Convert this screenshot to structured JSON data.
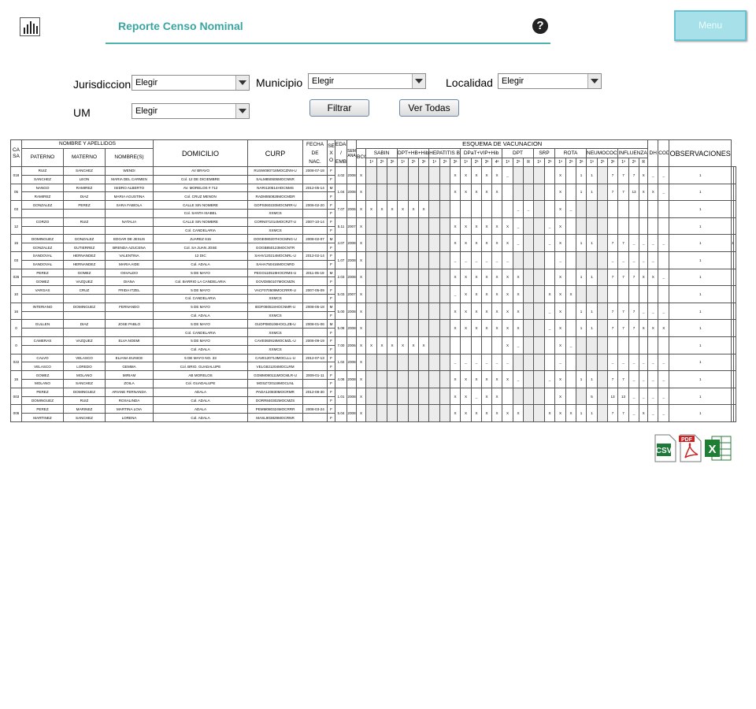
{
  "header": {
    "title": "Reporte Censo Nominal",
    "help_icon": "question-circle-icon",
    "help_symbol": "?",
    "menu_label": "Menu",
    "logo_icon": "bar-chart-icon"
  },
  "filters": {
    "jurisdiccion_label": "Jurisdiccion",
    "jurisdiccion_value": "Elegir",
    "municipio_label": "Municipio",
    "municipio_value": "Elegir",
    "localidad_label": "Localidad",
    "localidad_value": "Elegir",
    "um_label": "UM",
    "um_value": "Elegir",
    "filtrar_label": "Filtrar",
    "ver_todas_label": "Ver Todas"
  },
  "table": {
    "h_casa": "CASA",
    "h_nombre_apellidos": "NOMBRE Y APELLIDOS",
    "h_paterno": "PATERNO",
    "h_materno": "MATERNO",
    "h_nombres": "NOMBRE(S)",
    "h_domicilio": "DOMICILIO",
    "h_curp": "CURP",
    "h_fecha": "FECHA",
    "h_de": "DE",
    "h_nac": "NAC.",
    "h_sexo": "SEXO",
    "h_edad": "EDAD",
    "h_slash": "/",
    "h_emb": "EMB.",
    "h_semana": "SEMANA",
    "h_esquema": "ESQUEMA DE VACUNACION",
    "h_bcg": "BCG",
    "h_sabin": "SABIN",
    "h_dpt_hb_hib": "DPT+HB+Hib",
    "h_hepatitis": "HEPATITIS B",
    "h_dpat": "DPaT+VIP+Hib",
    "h_dpt": "DPT",
    "h_srp": "SRP",
    "h_rota": "ROTA",
    "h_neumococo": "NEUMOCOCO",
    "h_influenza": "INFLUENZA",
    "h_dh": "DH",
    "h_cod": "COD",
    "h_observaciones": "OBSERVACIONES",
    "dose_headers": [
      "1ª",
      "2ª",
      "3ª",
      "1ª",
      "2ª",
      "3ª",
      "1ª",
      "2ª",
      "3ª",
      "1ª",
      "2ª",
      "3ª",
      "4ª",
      "1ª",
      "2ª",
      "R",
      "1ª",
      "2ª",
      "1ª",
      "2ª",
      "3ª",
      "1ª",
      "2ª",
      "3ª",
      "1ª",
      "2ª",
      "R"
    ],
    "rows": [
      {
        "casa": "018",
        "a": [
          "RUIZ",
          "SANCHEZ",
          "WENDI",
          "AV BRAVO",
          "RUSW080718MOCZNN-U",
          "2008-07-18",
          "F"
        ],
        "b": [
          "SANCHEZ",
          "LEON",
          "MARIA DEL CARMEN",
          "Col. 12 DE DICIEMBRE",
          "SALM850606MOCNNR",
          "F"
        ],
        "edad": "4.02",
        "semana": "2008",
        "v": [
          "X",
          "",
          "",
          "",
          "",
          "",
          "",
          "",
          "",
          "X",
          "X",
          "X",
          "X",
          "X",
          "_",
          "",
          "",
          "",
          "",
          "X",
          "",
          "1",
          "1",
          "",
          "7",
          "7",
          "7",
          "X",
          "_",
          "_"
        ],
        "dh": "1",
        "cod": ""
      },
      {
        "casa": "05",
        "a": [
          "NANGO",
          "RAMIREZ",
          "ISIDRO ALBERTO",
          "AV. MORELOS # 712",
          "NARI120514HOCNMS",
          "2012-05-14",
          "M"
        ],
        "b": [
          "RAMIREZ",
          "DIAZ",
          "MARIA AGUSTINA",
          "Col. CRUZ MENON",
          "RADM850828MOCMDR",
          "F"
        ],
        "edad": "1.04",
        "semana": "2008",
        "v": [
          "X",
          "",
          "",
          "",
          "",
          "",
          "",
          "",
          "",
          "X",
          "X",
          "X",
          "X",
          "X",
          "",
          "",
          "",
          "",
          "",
          "X",
          "",
          "1",
          "1",
          "",
          "7",
          "7",
          "13",
          "X",
          "X",
          "_"
        ],
        "dh": "1",
        "cod": ""
      },
      {
        "casa": "03",
        "a": [
          "GONZALEZ",
          "PEREZ",
          "SARA FABIOLA",
          "CALLE SIN NOMBRE",
          "GOPS060220MOCNRR-U",
          "2006-02-20",
          "F"
        ],
        "b": [
          "",
          "",
          "",
          "Col. SANTA ISABEL",
          "XXMCS",
          "F"
        ],
        "edad": "7.07",
        "semana": "2006",
        "v": [
          "X",
          "X",
          "X",
          "X",
          "X",
          "X",
          "X",
          "",
          "",
          "",
          "",
          "",
          "",
          "",
          "",
          "_",
          "_",
          "",
          "",
          "X",
          "_",
          "",
          "",
          "",
          "",
          "",
          "",
          "",
          "",
          ""
        ],
        "dh": "1",
        "cod": ""
      },
      {
        "casa": "12",
        "a": [
          "CORZO",
          "RUIZ",
          "NATALIA",
          "CALLE SIN NOMBRE",
          "CORN071014MOCRZT-U",
          "2007-10-14",
          "F"
        ],
        "b": [
          "",
          "",
          "",
          "Col. CANDELARIA",
          "XXMCS",
          "F"
        ],
        "edad": "5.11",
        "semana": "2007",
        "v": [
          "X",
          "",
          "",
          "",
          "",
          "",
          "",
          "",
          "",
          "X",
          "X",
          "X",
          "X",
          "X",
          "X",
          "_",
          "",
          "",
          "_",
          "X",
          "",
          "",
          "",
          "",
          "",
          "",
          "",
          "",
          "",
          ""
        ],
        "dh": "1",
        "cod": ""
      },
      {
        "casa": "15",
        "a": [
          "DOMINGUEZ",
          "GONZALEZ",
          "EDGAR DE JESUS",
          "JUAREZ 615",
          "DOGE080207HOCMNG-U",
          "2008-02-07",
          "M"
        ],
        "b": [
          "GONZALEZ",
          "GUTIERREZ",
          "BRENDA AZUCENA",
          "Col. SA JUAN JOSE",
          "GOGB850123MOCNTR",
          "F"
        ],
        "edad": "4.07",
        "semana": "2008",
        "v": [
          "X",
          "",
          "",
          "",
          "",
          "",
          "",
          "",
          "",
          "X",
          "X",
          "X",
          "X",
          "X",
          "X",
          "_",
          "",
          "",
          "_",
          "X",
          "",
          "1",
          "1",
          "",
          "7",
          "7",
          "_",
          "_",
          "_",
          "_"
        ],
        "dh": "1",
        "cod": "1"
      },
      {
        "casa": "03",
        "a": [
          "SANDOVAL",
          "HERNANDEZ",
          "VALENTINA",
          "12 DIC",
          "SAHV120214MOCNRL-U",
          "2012-02-14",
          "F"
        ],
        "b": [
          "SANDOVAL",
          "HERNANDEZ",
          "MARIA AIDE",
          "Col. ADALA",
          "SAHA750416MOCNRD",
          "F"
        ],
        "edad": "1.07",
        "semana": "2008",
        "v": [
          "X",
          "",
          "",
          "",
          "",
          "",
          "",
          "",
          "",
          "_",
          "_",
          "_",
          "_",
          "_",
          "_",
          "",
          "",
          "",
          "",
          "_",
          "",
          "",
          "",
          "",
          "_",
          "_",
          "_",
          "_",
          "_",
          ""
        ],
        "dh": "1",
        "cod": ""
      },
      {
        "casa": "026",
        "a": [
          "PEREZ",
          "GOMEZ",
          "OSVALDO",
          "5 DE MAYO",
          "PEGO110519HOCRMS-U",
          "2011-05-19",
          "M"
        ],
        "b": [
          "GOMEZ",
          "VAZQUEZ",
          "DIANA",
          "Col. BARRIO LA CANDELARIA",
          "GOVD850107MOCMZN",
          "F"
        ],
        "edad": "2.03",
        "semana": "2008",
        "v": [
          "X",
          "",
          "",
          "",
          "",
          "",
          "",
          "",
          "",
          "X",
          "X",
          "X",
          "X",
          "X",
          "X",
          "X",
          "",
          "",
          "",
          "X",
          "",
          "1",
          "1",
          "",
          "7",
          "7",
          "7",
          "X",
          "X",
          "_"
        ],
        "dh": "1",
        "cod": ""
      },
      {
        "casa": "10",
        "a": [
          "VARGAS",
          "CRUZ",
          "FRIDA ITZEL",
          "5 DE MAYO",
          "VACF070509MOCRRR-U",
          "2007-05-09",
          "F"
        ],
        "b": [
          "",
          "",
          "",
          "Col. CANDELARIA",
          "XXMCS",
          "F"
        ],
        "edad": "5.03",
        "semana": "2007",
        "v": [
          "X",
          "",
          "",
          "",
          "",
          "",
          "",
          "",
          "",
          "_",
          "X",
          "X",
          "X",
          "X",
          "X",
          "X",
          "",
          "",
          "X",
          "X",
          "X",
          "",
          "",
          "",
          "",
          "",
          "",
          "",
          "",
          ""
        ],
        "dh": "1",
        "cod": ""
      },
      {
        "casa": "16",
        "a": [
          "INTERIANO",
          "DOMINGUEZ",
          "FERNANDO",
          "5 DE MAYO",
          "IEDF080518HOCNMR-U",
          "2008-05-18",
          "M"
        ],
        "b": [
          "",
          "",
          "",
          "Col. ADALA",
          "XXMCS",
          "F"
        ],
        "edad": "5.00",
        "semana": "2008",
        "v": [
          "X",
          "",
          "",
          "",
          "",
          "",
          "",
          "",
          "",
          "X",
          "X",
          "X",
          "X",
          "X",
          "X",
          "X",
          "",
          "",
          "_",
          "X",
          "",
          "1",
          "1",
          "",
          "7",
          "7",
          "7",
          "_",
          "_",
          "_"
        ],
        "dh": "1",
        "cod": ""
      },
      {
        "casa": "0",
        "a": [
          "GULLEN",
          "DIAZ",
          "JOSE PABLO",
          "5 DE MAYO",
          "GUDP080106HOCLZB-U",
          "2008-01-06",
          "M"
        ],
        "b": [
          "",
          "",
          "",
          "Col. CANDELARIA",
          "XXMCS",
          "F"
        ],
        "edad": "5.08",
        "semana": "2008",
        "v": [
          "X",
          "",
          "",
          "",
          "",
          "",
          "",
          "",
          "",
          "X",
          "X",
          "X",
          "X",
          "X",
          "X",
          "X",
          "",
          "",
          "_",
          "X",
          "",
          "1",
          "1",
          "",
          "7",
          "7",
          "7",
          "X",
          "X",
          "X"
        ],
        "dh": "1",
        "cod": ""
      },
      {
        "casa": "0",
        "a": [
          "CAMERAS",
          "VAZQUEZ",
          "ELVA NOEMI",
          "5 DE MAYO",
          "CAVE060919MOCMZL-U",
          "2006-09-19",
          "F"
        ],
        "b": [
          "",
          "",
          "",
          "Col. ADALA",
          "XXMCS",
          "F"
        ],
        "edad": "7.00",
        "semana": "2006",
        "v": [
          "X",
          "X",
          "X",
          "X",
          "X",
          "X",
          "X",
          "",
          "",
          "",
          "",
          "",
          "",
          "",
          "X",
          "_",
          "",
          "",
          "",
          "X",
          "_",
          "",
          "",
          "",
          "",
          "",
          "",
          "",
          "",
          ""
        ],
        "dh": "1",
        "cod": ""
      },
      {
        "casa": "022",
        "a": [
          "CALVO",
          "VELASCO",
          "ELIANA EUNICE",
          "5 DE MAYO NO. 33",
          "CAVE120713MOCLLL-U",
          "2012-07-13",
          "F"
        ],
        "b": [
          "VELASCO",
          "LOREDO",
          "GEMMA",
          "Col. BRIO. GUADALUPE",
          "VELG821204MOCLRM",
          "F"
        ],
        "edad": "1.02",
        "semana": "2008",
        "v": [
          "X",
          "",
          "",
          "",
          "",
          "",
          "",
          "",
          "",
          "_",
          "_",
          "_",
          "_",
          "_",
          "_",
          "",
          "",
          "",
          "",
          "_",
          "",
          "",
          "",
          "",
          "_",
          "_",
          "_",
          "_",
          "_",
          "_"
        ],
        "dh": "1",
        "cod": ""
      },
      {
        "casa": "15",
        "a": [
          "GOMEZ",
          "MOLANO",
          "MIRIAM",
          "AB MORELOS",
          "GOMM090111MOCMLR-U",
          "2009-01-11",
          "F"
        ],
        "b": [
          "MOLANO",
          "SANCHEZ",
          "ZOILA",
          "Col. GUADALUPE",
          "MOSZ720119MOCLNL",
          "F"
        ],
        "edad": "4.06",
        "semana": "2008",
        "v": [
          "X",
          "",
          "",
          "",
          "",
          "",
          "",
          "",
          "",
          "X",
          "X",
          "X",
          "X",
          "X",
          "X",
          "_",
          "",
          "",
          "_",
          "X",
          "",
          "1",
          "1",
          "",
          "7",
          "7",
          "_",
          "_",
          "_",
          "_"
        ],
        "dh": "1",
        "cod": ""
      },
      {
        "casa": "003",
        "a": [
          "PEREZ",
          "DOMINGUEZ",
          "ARIANE FERNANDA",
          "ADALA",
          "PADA120830MOCRMR",
          "2012-08-30",
          "F"
        ],
        "b": [
          "DOMINGUEZ",
          "RUIZ",
          "ROSALINDA",
          "Col. ADALA",
          "DORR840302MOCMZS",
          "F"
        ],
        "edad": "1.01",
        "semana": "2008",
        "v": [
          "X",
          "",
          "",
          "",
          "",
          "",
          "",
          "",
          "",
          "X",
          "X",
          "_",
          "X",
          "X",
          "",
          "",
          "",
          "",
          "",
          "X",
          "",
          "",
          "5",
          "",
          "13",
          "13",
          "_",
          "_",
          "_",
          "_"
        ],
        "dh": "1",
        "cod": ""
      },
      {
        "casa": "006",
        "a": [
          "PEREZ",
          "MARINEZ",
          "MARTINA LOIA",
          "ADALA",
          "PEMM080324MOCRRR",
          "2008-03-24",
          "F"
        ],
        "b": [
          "MARTINEZ",
          "SANCHEZ",
          "LORENA",
          "Col. ADALA",
          "MASL903829MOCRNR",
          "F"
        ],
        "edad": "5.04",
        "semana": "2008",
        "v": [
          "X",
          "",
          "",
          "",
          "",
          "",
          "",
          "",
          "",
          "X",
          "X",
          "X",
          "X",
          "X",
          "X",
          "X",
          "",
          "",
          "X",
          "X",
          "X",
          "1",
          "1",
          "",
          "7",
          "7",
          "_",
          "X",
          "_",
          "_"
        ],
        "dh": "1",
        "cod": ""
      }
    ]
  },
  "exports": [
    {
      "name": "csv-export-icon",
      "label": "CSV"
    },
    {
      "name": "pdf-export-icon",
      "label": "PDF"
    },
    {
      "name": "excel-export-icon",
      "label": "X"
    }
  ]
}
